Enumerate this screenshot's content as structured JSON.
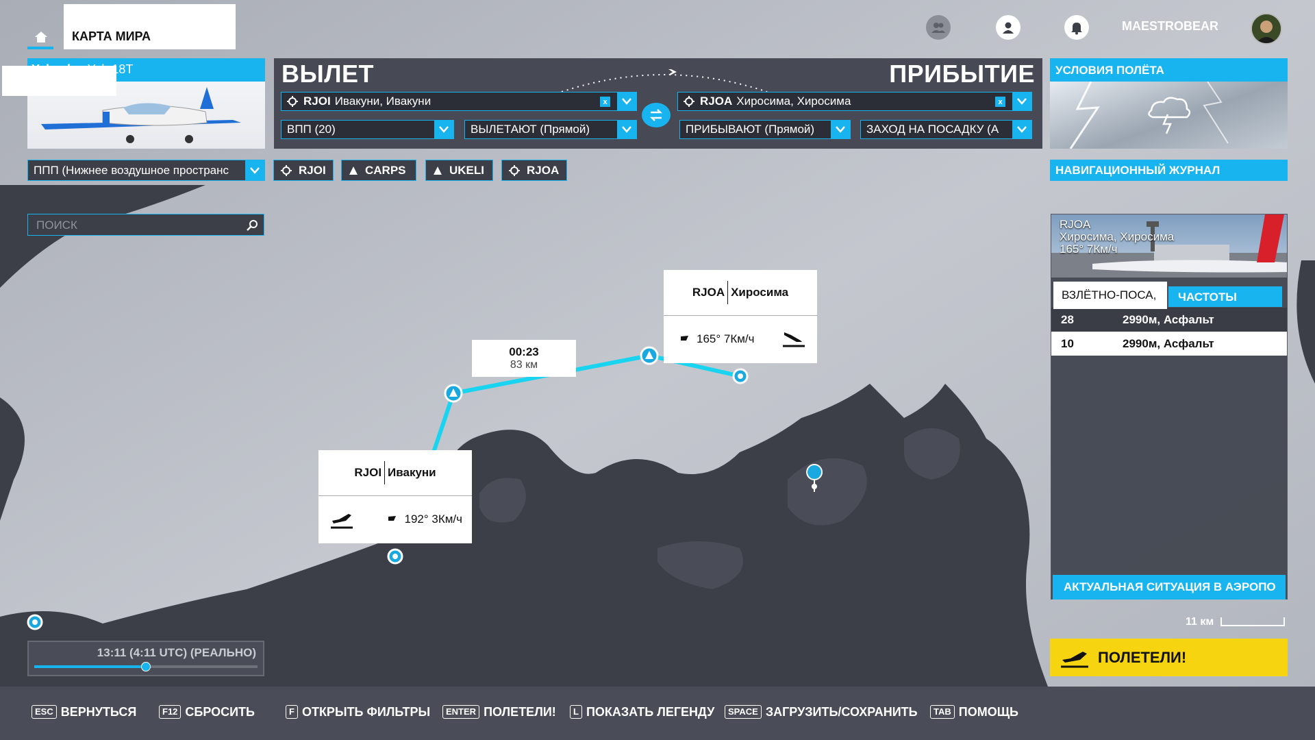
{
  "topbar": {
    "tab_title": "КАРТА МИРА",
    "username": "MAESTROBEAR"
  },
  "aircraft": {
    "maker": "Yakovlev",
    "model": "Yak-18T"
  },
  "departure": {
    "title": "ВЫЛЕТ",
    "airport_code": "RJOI",
    "airport_name": "Ивакуни, Ивакуни",
    "runway": "ВПП (20)",
    "procedure": "ВЫЛЕТАЮТ (Прямой)"
  },
  "arrival": {
    "title": "ПРИБЫТИЕ",
    "airport_code": "RJOA",
    "airport_name": "Хиросима, Хиросима",
    "procedure": "ПРИБЫВАЮТ (Прямой)",
    "approach": "ЗАХОД НА ПОСАДКУ (А"
  },
  "conditions": {
    "title": "УСЛОВИЯ ПОЛЁТА"
  },
  "waypoints_bar": {
    "flight_rules": "ППП (Нижнее воздушное пространс",
    "chips": [
      {
        "icon": "airport-icon",
        "label": "RJOI"
      },
      {
        "icon": "waypoint-triangle-icon",
        "label": "CARPS"
      },
      {
        "icon": "waypoint-triangle-icon",
        "label": "UKELI"
      },
      {
        "icon": "airport-icon",
        "label": "RJOA"
      }
    ],
    "nav_log": "НАВИГАЦИОННЫЙ ЖУРНАЛ"
  },
  "search": {
    "placeholder": "ПОИСК"
  },
  "map": {
    "leg_time": "00:23",
    "leg_distance": "83 км",
    "origin_popup": {
      "code": "RJOI",
      "name": "Ивакуни",
      "wind": "192° 3Км/ч"
    },
    "dest_popup": {
      "code": "RJOA",
      "name": "Хиросима",
      "wind": "165° 7Км/ч"
    },
    "scale": "11 км"
  },
  "airport_info": {
    "code": "RJOA",
    "name": "Хиросима, Хиросима",
    "wind": "165° 7Км/ч",
    "tab_runways": "ВЗЛЁТНО-ПОСА,",
    "tab_freq": "ЧАСТОТЫ",
    "runways": [
      {
        "id": "28",
        "info": "2990м, Асфальт"
      },
      {
        "id": "10",
        "info": "2990м, Асфальт"
      }
    ],
    "footer": "АКТУАЛЬНАЯ СИТУАЦИЯ В АЭРОПО"
  },
  "fly_button": "ПОЛЕТЕЛИ!",
  "time_widget": {
    "label": "13:11 (4:11 UTC) (РЕАЛЬНО)",
    "progress": 0.5
  },
  "shortcuts": [
    {
      "key": "ESC",
      "label": "ВЕРНУТЬСЯ"
    },
    {
      "key": "F12",
      "label": "СБРОСИТЬ"
    },
    {
      "key": "F",
      "label": "ОТКРЫТЬ ФИЛЬТРЫ"
    },
    {
      "key": "ENTER",
      "label": "ПОЛЕТЕЛИ!"
    },
    {
      "key": "L",
      "label": "ПОКАЗАТЬ ЛЕГЕНДУ"
    },
    {
      "key": "SPACE",
      "label": "ЗАГРУЗИТЬ/СОХРАНИТЬ"
    },
    {
      "key": "TAB",
      "label": "ПОМОЩЬ"
    }
  ],
  "colors": {
    "accent": "#18b4f0",
    "fly": "#f6d40f",
    "sea": "#bfc3cb",
    "land": "#3c3f48"
  }
}
